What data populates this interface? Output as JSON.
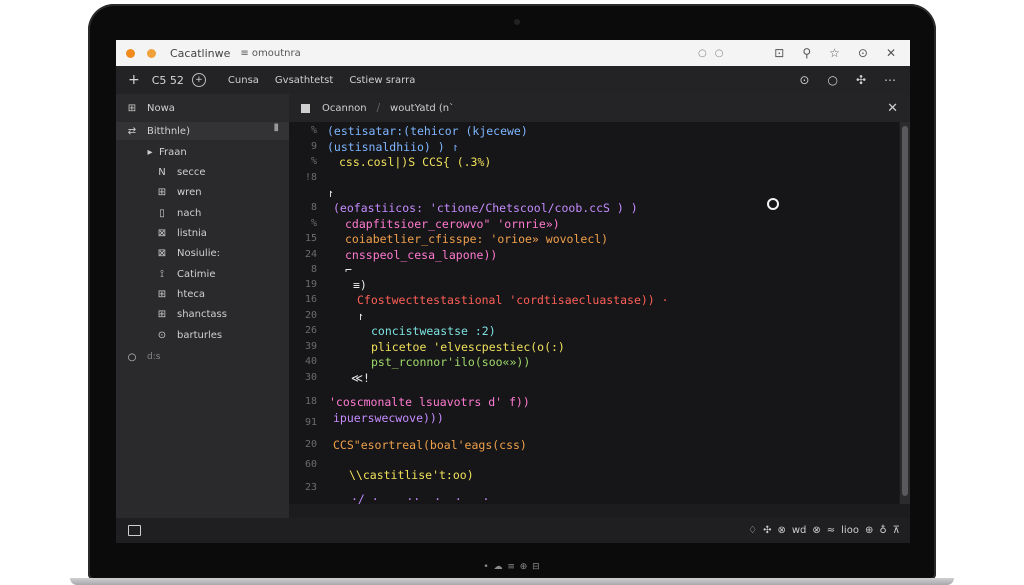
{
  "brand": "• ☁ ≡ ⊕ ⊟",
  "titlebar": {
    "app_title": "Cacatlinwe",
    "url": "≡ omoutnra",
    "mid_icons": [
      "○",
      "○"
    ],
    "right_icons": [
      "⊡",
      "⚲",
      "☆",
      "⊙",
      "✕"
    ]
  },
  "toolbar": {
    "plus": "+",
    "css_label": "C5 52",
    "circle_icon": "+",
    "menu": [
      "Cunsa",
      "Gvsathtetst",
      "Cstiew srarra"
    ],
    "right_icons": [
      "⊙",
      "○",
      "✣",
      "⋯"
    ]
  },
  "sidebar": {
    "items": [
      {
        "icon": "⊞",
        "label": "Nowa"
      },
      {
        "icon": "⇄",
        "label": "Bitthnle)"
      },
      {
        "icon": "▸",
        "label": "Fraan"
      },
      {
        "icon": "N",
        "label": "secce"
      },
      {
        "icon": "⊞",
        "label": "wren"
      },
      {
        "icon": "▯",
        "label": "nach"
      },
      {
        "icon": "⊠",
        "label": "listnia"
      },
      {
        "icon": "⊠",
        "label": "Nosiulie:"
      },
      {
        "icon": "⟟",
        "label": "Catimie"
      },
      {
        "icon": "⊞",
        "label": "hteca"
      },
      {
        "icon": "⊞",
        "label": "shanctass"
      },
      {
        "icon": "⊙",
        "label": "barturles"
      },
      {
        "icon": "○",
        "label": "d:s"
      }
    ]
  },
  "editor": {
    "tab_label": "Ocannon",
    "tab_divider": "⧸",
    "tab2_label": "woutYatd  (n`",
    "close": "✕",
    "line_numbers": [
      "%",
      "9",
      "%",
      "!8",
      "8",
      "%",
      "15",
      "24",
      "8",
      "19",
      "16",
      "20",
      "26",
      "39",
      "40",
      "30",
      "18",
      "91",
      "20",
      "60",
      "23"
    ],
    "lines": [
      "(estisatar:(tehicor (kjecewe)",
      "(ustisnaldhiio) ) ↾",
      "css.cosl|)S CCS{ (.3%)",
      "↾",
      "(eofastiicos: 'ctione/Chetscool/coob.ccS ) )",
      "cdapfitsioer_cerowvo\" 'ornrie»)",
      "coiabetlier_cfisspe: 'orioe» wovolecl)",
      "cnsspeol_cesa_lapone))",
      "⌐",
      "≡)",
      "Cfostwecttestastional 'cordtisaecluastase)) ·",
      "↾",
      "concistweastse :2)",
      "plicetoe 'elvescpestiec(o(:)",
      "pst_rconnor'ilo(soo«»))",
      "≪!",
      "'coscmonalte lsuavotrs d' f))",
      "ipuerswecwove)))",
      "CCS\"esortreal(boal'eags(css)",
      "\\\\castitlise't:oo)",
      "·/ ·    ··  ·  ·   ·"
    ]
  },
  "status": {
    "right": [
      "♢",
      "✣",
      "⊗",
      "wd",
      "⊗",
      "≈",
      "lioo",
      "⊕",
      "♁",
      "⊼"
    ]
  }
}
